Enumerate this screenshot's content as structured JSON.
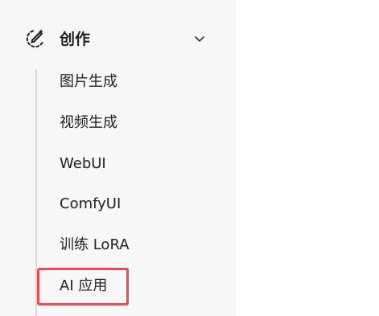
{
  "section": {
    "label": "创作",
    "icon": "wand-sparkle-icon",
    "expanded": true
  },
  "items": [
    {
      "label": "图片生成"
    },
    {
      "label": "视频生成"
    },
    {
      "label": "WebUI"
    },
    {
      "label": "ComfyUI"
    },
    {
      "label": "训练 LoRA"
    },
    {
      "label": "AI 应用"
    }
  ],
  "highlight": {
    "target": "AI 应用",
    "color": "#ea4b54"
  }
}
